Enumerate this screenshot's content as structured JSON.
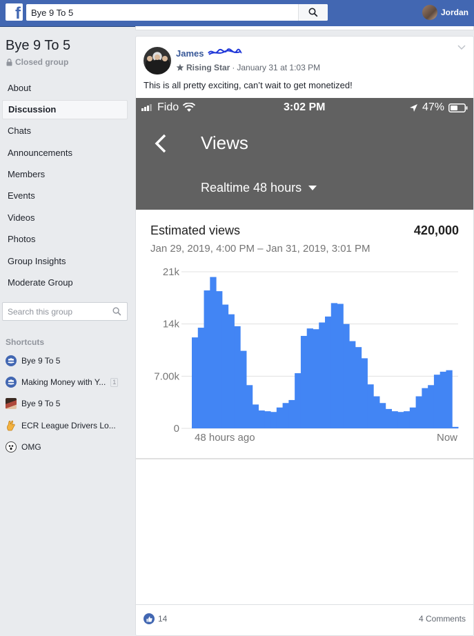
{
  "topbar": {
    "search_value": "Bye 9 To 5",
    "user_name": "Jordan",
    "logo_letter": "f",
    "brand_color": "#4267b2"
  },
  "group": {
    "name": "Bye 9 To 5",
    "type": "Closed group"
  },
  "nav": [
    {
      "label": "About",
      "active": false
    },
    {
      "label": "Discussion",
      "active": true
    },
    {
      "label": "Chats",
      "active": false
    },
    {
      "label": "Announcements",
      "active": false
    },
    {
      "label": "Members",
      "active": false
    },
    {
      "label": "Events",
      "active": false
    },
    {
      "label": "Videos",
      "active": false
    },
    {
      "label": "Photos",
      "active": false
    },
    {
      "label": "Group Insights",
      "active": false
    },
    {
      "label": "Moderate Group",
      "active": false
    }
  ],
  "group_search": {
    "placeholder": "Search this group"
  },
  "shortcuts": {
    "title": "Shortcuts",
    "items": [
      {
        "label": "Bye 9 To 5",
        "icon": "group-icon"
      },
      {
        "label": "Making Money with Y...",
        "icon": "group-icon",
        "badge": "1"
      },
      {
        "label": "Bye 9 To 5",
        "icon": "group-photo-icon"
      },
      {
        "label": "ECR League Drivers Lo...",
        "icon": "hand-emoji-icon"
      },
      {
        "label": "OMG",
        "icon": "face-emoji-icon"
      }
    ]
  },
  "post": {
    "author": "James",
    "badge": "Rising Star",
    "separator": "·",
    "date": "January 31 at 1:03 PM",
    "text": "This is all pretty exciting, can’t wait to get monetized!",
    "likes": "14",
    "comments": "4 Comments"
  },
  "phone": {
    "carrier": "Fido",
    "time": "3:02 PM",
    "battery": "47%",
    "screen_title": "Views",
    "range": "Realtime 48 hours",
    "metric_label": "Estimated views",
    "metric_value": "420,000",
    "date_range": "Jan 29, 2019, 4:00 PM – Jan 31, 2019, 3:01 PM"
  },
  "chart_data": {
    "type": "bar",
    "title": "Estimated views",
    "xlabel": "",
    "ylabel": "",
    "ylim": [
      0,
      21000
    ],
    "y_ticks": [
      0,
      7000,
      14000,
      21000
    ],
    "y_tick_labels": [
      "0",
      "7.00k",
      "14k",
      "21k"
    ],
    "x_tick_labels": [
      "48 hours ago",
      "Now"
    ],
    "grid": true,
    "color": "#4285f4",
    "values": [
      12200,
      13500,
      18500,
      20300,
      18400,
      16600,
      15300,
      13700,
      10400,
      5800,
      3200,
      2400,
      2300,
      2200,
      2800,
      3400,
      3800,
      7400,
      12400,
      13400,
      13300,
      14200,
      15000,
      16800,
      16700,
      14000,
      11700,
      10900,
      9400,
      5900,
      4300,
      3400,
      2600,
      2300,
      2200,
      2300,
      2800,
      4300,
      5400,
      5800,
      7200,
      7600,
      7800,
      200
    ]
  }
}
